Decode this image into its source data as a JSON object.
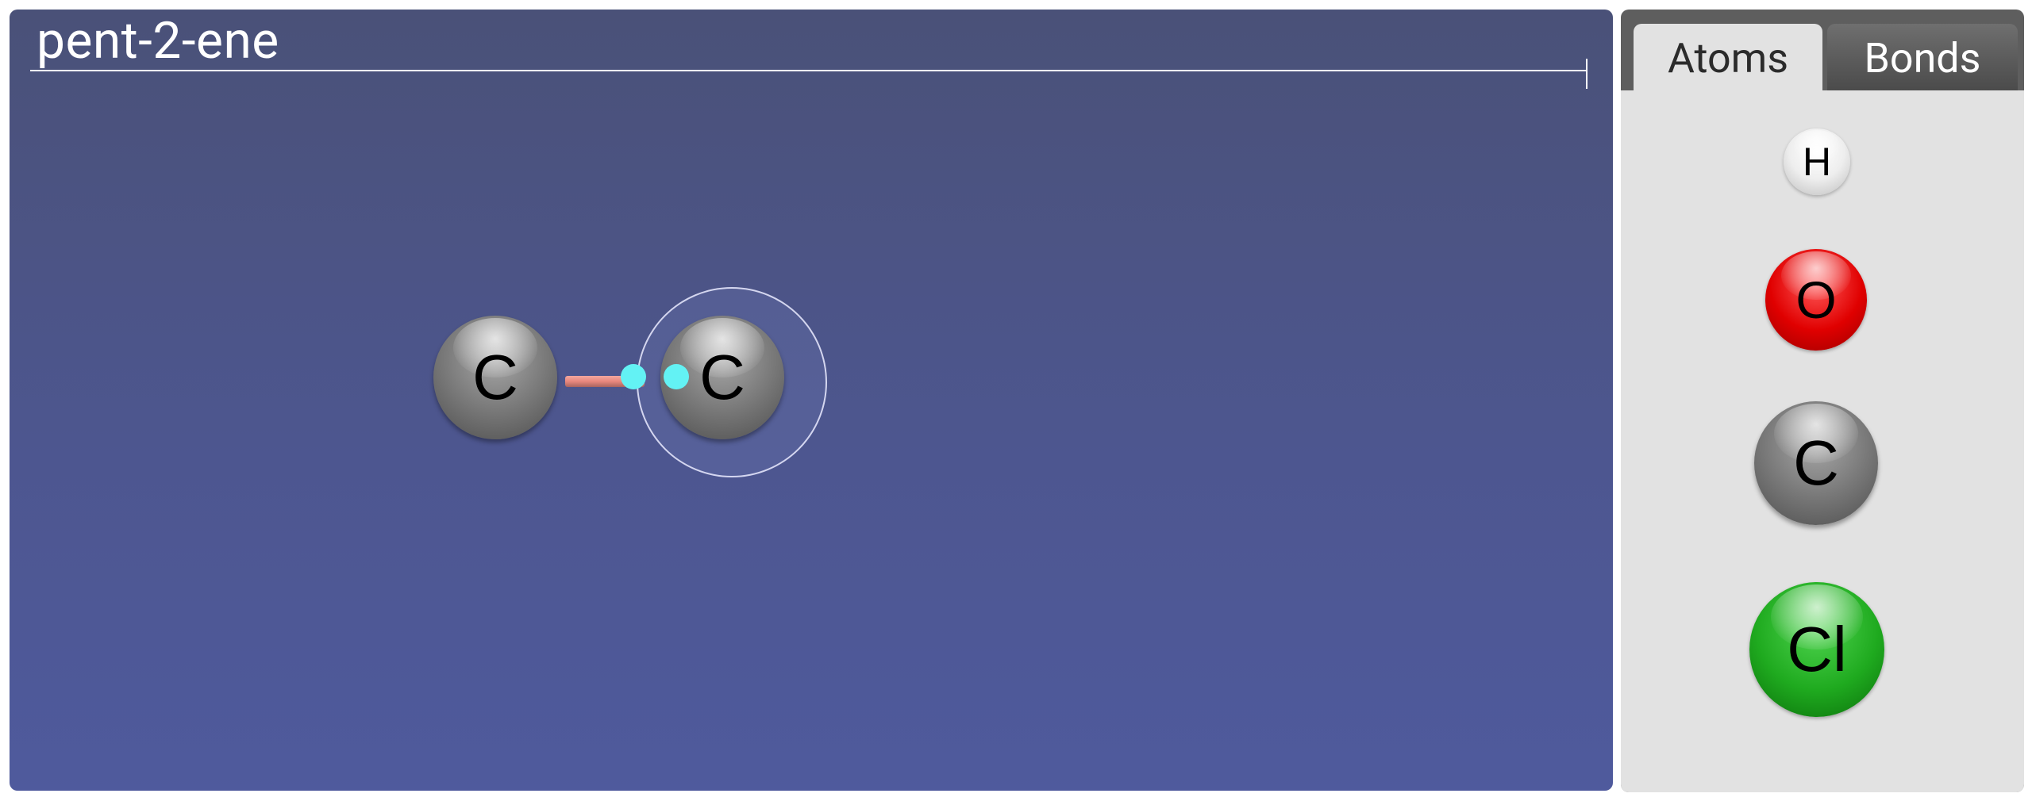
{
  "molecule": {
    "name": "pent-2-ene"
  },
  "canvas": {
    "atoms": [
      {
        "symbol": "C",
        "element": "carbon"
      },
      {
        "symbol": "C",
        "element": "carbon",
        "selected": true
      }
    ],
    "bond_color": "#e8877d",
    "handle_color": "#63f2f4"
  },
  "panel": {
    "tabs": [
      {
        "label": "Atoms",
        "active": true
      },
      {
        "label": "Bonds",
        "active": false
      }
    ],
    "palette": [
      {
        "symbol": "H",
        "element": "hydrogen",
        "color": "#eeeeee"
      },
      {
        "symbol": "O",
        "element": "oxygen",
        "color": "#e00000"
      },
      {
        "symbol": "C",
        "element": "carbon",
        "color": "#7e7e7e"
      },
      {
        "symbol": "Cl",
        "element": "chlorine",
        "color": "#1faa1f"
      }
    ]
  },
  "colors": {
    "background_top": "#4a5178",
    "background_bottom": "#4f5a9d",
    "panel_bg": "#e2e2e2"
  }
}
